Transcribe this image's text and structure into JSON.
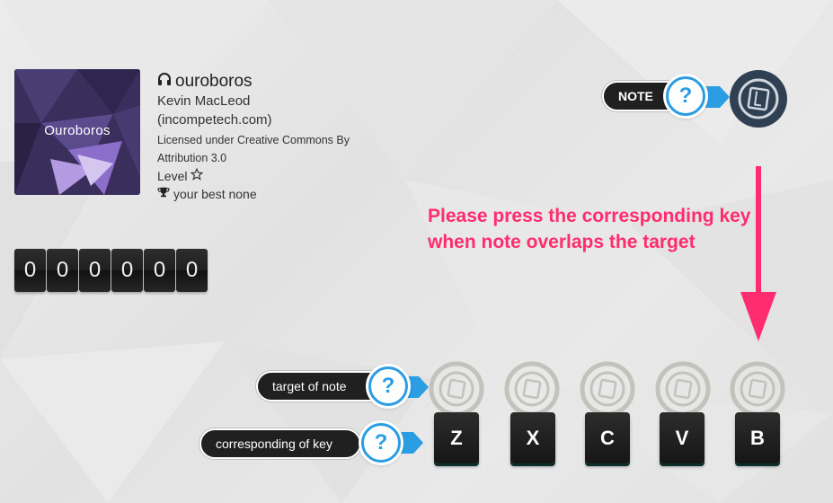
{
  "song": {
    "cover_label": "Ouroboros",
    "title": "ouroboros",
    "artist": "Kevin MacLeod",
    "artist_site": "(incompetech.com)",
    "license": "Licensed under Creative Commons By Attribution 3.0",
    "level_label": "Level",
    "best_label": "your best none"
  },
  "score": {
    "digits": [
      "0",
      "0",
      "0",
      "0",
      "0",
      "0"
    ]
  },
  "tooltips": {
    "note": "NOTE",
    "target": "target of note",
    "key": "corresponding of key",
    "help_glyph": "?"
  },
  "instruction": "Please press the corresponding key when note overlaps the target",
  "keys": [
    "Z",
    "X",
    "C",
    "V",
    "B"
  ],
  "colors": {
    "accent_blue": "#2a9de3",
    "instruction_pink": "#ff2d6f",
    "note_circle": "#2f4052",
    "key_bg": "#1f1f1f"
  },
  "icons": {
    "title": "headphones-icon",
    "level": "star-outline-icon",
    "best": "trophy-icon",
    "target": "target-ring-icon"
  }
}
